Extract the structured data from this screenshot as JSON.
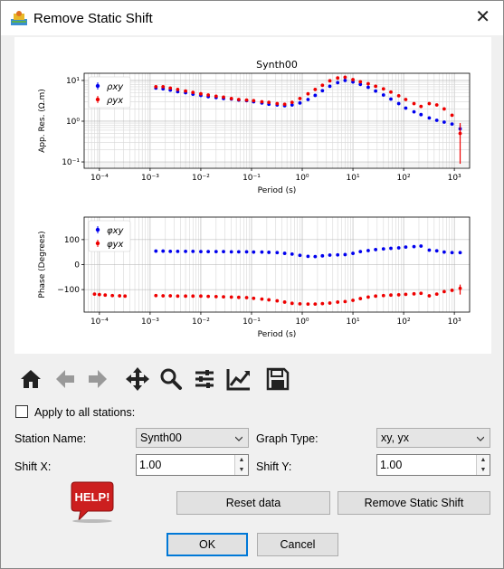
{
  "window": {
    "title": "Remove Static Shift",
    "close_glyph": "✕"
  },
  "toolbar": {
    "icons": [
      "home-icon",
      "back-arrow-icon",
      "forward-arrow-icon",
      "pan-icon",
      "zoom-icon",
      "subplots-settings-icon",
      "edit-axes-icon",
      "save-icon"
    ]
  },
  "form": {
    "apply_all_label": "Apply to all stations:",
    "apply_all_checked": false,
    "station_label": "Station Name:",
    "station_value": "Synth00",
    "graph_type_label": "Graph Type:",
    "graph_type_value": "xy, yx",
    "shift_x_label": "Shift X:",
    "shift_x_value": "1.00",
    "shift_y_label": "Shift Y:",
    "shift_y_value": "1.00",
    "help_label": "HELP!",
    "reset_label": "Reset data",
    "remove_label": "Remove Static Shift",
    "ok_label": "OK",
    "cancel_label": "Cancel"
  },
  "colors": {
    "xy": "#0000ee",
    "yx": "#ee0000",
    "help_red": "#cc1f1f",
    "ok_border": "#0078d7"
  },
  "chart_data": [
    {
      "type": "scatter",
      "title": "Synth00",
      "xlabel": "Period (s)",
      "ylabel": "App. Res. (Ω.m)",
      "x_scale": "log",
      "y_scale": "log",
      "xlim": [
        5e-05,
        2000
      ],
      "ylim": [
        0.07,
        15
      ],
      "xticks": [
        "10⁻⁴",
        "10⁻³",
        "10⁻²",
        "10⁻¹",
        "10⁰",
        "10¹",
        "10²",
        "10³"
      ],
      "yticks": [
        "10¹",
        "10⁰",
        "10⁻¹"
      ],
      "legend": [
        "ρxy",
        "ρyx"
      ],
      "legend_position": "top-left",
      "grid": true,
      "series": [
        {
          "name": "ρxy",
          "color": "#0000ee",
          "x": [
            0.0013,
            0.0018,
            0.0025,
            0.0035,
            0.005,
            0.007,
            0.01,
            0.014,
            0.02,
            0.028,
            0.04,
            0.056,
            0.08,
            0.11,
            0.16,
            0.22,
            0.32,
            0.45,
            0.63,
            0.9,
            1.3,
            1.8,
            2.5,
            3.5,
            5,
            7,
            10,
            14,
            20,
            28,
            40,
            56,
            80,
            110,
            160,
            220,
            320,
            450,
            630,
            900,
            1300
          ],
          "y": [
            6.5,
            6.2,
            5.8,
            5.3,
            5.0,
            4.6,
            4.3,
            4.0,
            3.8,
            3.6,
            3.5,
            3.3,
            3.2,
            3.0,
            2.8,
            2.6,
            2.5,
            2.4,
            2.5,
            2.8,
            3.4,
            4.3,
            5.6,
            7.2,
            8.8,
            10.0,
            9.2,
            8.0,
            6.8,
            5.5,
            4.4,
            3.5,
            2.7,
            2.1,
            1.7,
            1.45,
            1.2,
            1.05,
            0.95,
            0.85,
            0.65
          ],
          "err_last": [
            0.5,
            0.8
          ]
        },
        {
          "name": "ρyx",
          "color": "#ee0000",
          "x": [
            0.0013,
            0.0018,
            0.0025,
            0.0035,
            0.005,
            0.007,
            0.01,
            0.014,
            0.02,
            0.028,
            0.04,
            0.056,
            0.08,
            0.11,
            0.16,
            0.22,
            0.32,
            0.45,
            0.63,
            0.9,
            1.3,
            1.8,
            2.5,
            3.5,
            5,
            7,
            10,
            14,
            20,
            28,
            40,
            56,
            80,
            110,
            160,
            220,
            320,
            450,
            630,
            900,
            1300
          ],
          "y": [
            7.0,
            7.0,
            6.5,
            6.0,
            5.5,
            5.1,
            4.7,
            4.4,
            4.1,
            3.9,
            3.6,
            3.4,
            3.3,
            3.2,
            3.0,
            2.9,
            2.7,
            2.6,
            2.9,
            3.6,
            4.7,
            6.0,
            7.6,
            9.8,
            11.5,
            12.0,
            10.5,
            9.3,
            8.3,
            7.2,
            6.2,
            5.2,
            4.2,
            3.4,
            2.7,
            2.3,
            2.7,
            2.5,
            2.0,
            1.4,
            0.5
          ],
          "err_last": [
            0.09,
            0.9
          ]
        }
      ]
    },
    {
      "type": "scatter",
      "xlabel": "Period (s)",
      "ylabel": "Phase (Degrees)",
      "x_scale": "log",
      "xlim": [
        5e-05,
        2000
      ],
      "ylim": [
        -190,
        190
      ],
      "xticks": [
        "10⁻⁴",
        "10⁻³",
        "10⁻²",
        "10⁻¹",
        "10⁰",
        "10¹",
        "10²",
        "10³"
      ],
      "yticks": [
        "100",
        "0",
        "−100"
      ],
      "legend": [
        "φxy",
        "φyx"
      ],
      "legend_position": "top-left",
      "grid": true,
      "series": [
        {
          "name": "φxy",
          "color": "#0000ee",
          "x": [
            0.0013,
            0.0018,
            0.0025,
            0.0035,
            0.005,
            0.007,
            0.01,
            0.014,
            0.02,
            0.028,
            0.04,
            0.056,
            0.08,
            0.11,
            0.16,
            0.22,
            0.32,
            0.45,
            0.63,
            0.9,
            1.3,
            1.8,
            2.5,
            3.5,
            5,
            7,
            10,
            14,
            20,
            28,
            40,
            56,
            80,
            110,
            160,
            220,
            320,
            450,
            630,
            900,
            1300
          ],
          "y": [
            54,
            54,
            53,
            53,
            53,
            53,
            52,
            52,
            52,
            52,
            51,
            51,
            51,
            50,
            50,
            49,
            48,
            45,
            42,
            37,
            33,
            32,
            35,
            38,
            39,
            40,
            45,
            52,
            56,
            60,
            63,
            65,
            67,
            70,
            72,
            74,
            58,
            55,
            50,
            48,
            48
          ]
        },
        {
          "name": "φyx",
          "color": "#ee0000",
          "x": [
            8e-05,
            0.0001,
            0.00013,
            0.00018,
            0.00025,
            0.00032,
            0.0013,
            0.0018,
            0.0025,
            0.0035,
            0.005,
            0.007,
            0.01,
            0.014,
            0.02,
            0.028,
            0.04,
            0.056,
            0.08,
            0.11,
            0.16,
            0.22,
            0.32,
            0.45,
            0.63,
            0.9,
            1.3,
            1.8,
            2.5,
            3.5,
            5,
            7,
            10,
            14,
            20,
            28,
            40,
            56,
            80,
            110,
            160,
            220,
            320,
            450,
            630,
            900,
            1300
          ],
          "y": [
            -118,
            -120,
            -122,
            -124,
            -125,
            -126,
            -124,
            -125,
            -125,
            -126,
            -126,
            -126,
            -126,
            -127,
            -128,
            -129,
            -130,
            -131,
            -132,
            -135,
            -138,
            -141,
            -145,
            -150,
            -155,
            -157,
            -158,
            -158,
            -156,
            -154,
            -150,
            -148,
            -143,
            -136,
            -130,
            -126,
            -124,
            -122,
            -121,
            -119,
            -117,
            -115,
            -125,
            -118,
            -108,
            -103,
            -95
          ],
          "err_last": [
            -120,
            -80
          ]
        }
      ]
    }
  ]
}
